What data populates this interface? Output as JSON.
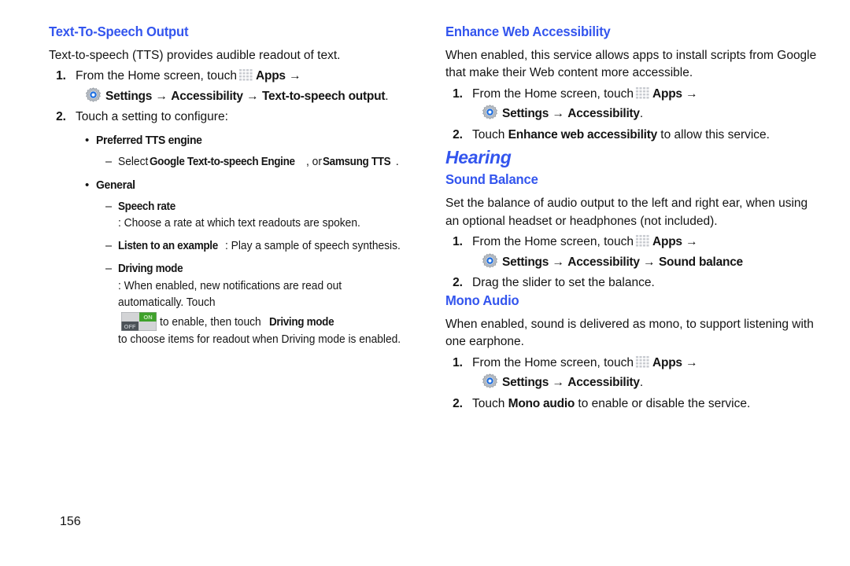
{
  "page": {
    "number": "156",
    "heading_color": "#3355ee",
    "text_color": "#141414"
  },
  "icons": {
    "apps": "apps-grid-icon",
    "settings": "settings-gear-icon",
    "toggle": "on-off-toggle-icon",
    "toggle_on_label": "ON",
    "toggle_off_label": "OFF"
  },
  "arrow": "→",
  "bullet_mark": "•",
  "dash_mark": "–",
  "left_column": {
    "tts": {
      "title": "Text-To-Speech Output",
      "intro": "Text-to-speech (TTS) provides audible readout of text.",
      "step1_num": "1.",
      "step1_text": "From the Home screen, touch",
      "step1_apps": "Apps",
      "step1_settings": "Settings",
      "step1_accessibility": "Accessibility",
      "step1_target": "Text-to-speech output",
      "step1_period": ".",
      "step2_num": "2.",
      "step2_text": "Touch a setting to configure:",
      "bullet1": "Preferred TTS engine",
      "bullet1_dash_pre": "Select ",
      "bullet1_dash_b1": "Google Text-to-speech Engine",
      "bullet1_dash_mid": ", or ",
      "bullet1_dash_b2": "Samsung TTS",
      "bullet1_dash_end": ".",
      "bullet2": "General",
      "dash_speech_rate_label": "Speech rate",
      "dash_speech_rate_text": ": Choose a rate at which text readouts are spoken.",
      "dash_listen_label": "Listen to an example",
      "dash_listen_text": ": Play a sample of speech synthesis.",
      "dash_driving_label": "Driving mode",
      "dash_driving_text1": ": When enabled, new notifications are read out automatically. Touch",
      "dash_driving_text2": "to enable, then touch",
      "dash_driving_b2": "Driving mode",
      "dash_driving_text3": "to choose items for readout when Driving mode is enabled."
    }
  },
  "right_column": {
    "enhance_web": {
      "title": "Enhance Web Accessibility",
      "intro": "When enabled, this service allows apps to install scripts from Google that make their Web content more accessible.",
      "step1_num": "1.",
      "step1_text": "From the Home screen, touch",
      "step1_apps": "Apps",
      "step1_settings": "Settings",
      "step1_accessibility": "Accessibility",
      "step1_period": ".",
      "step2_num": "2.",
      "step2_pre": "Touch ",
      "step2_bold": "Enhance web accessibility",
      "step2_post": " to allow this service."
    },
    "hearing_group": "Hearing",
    "sound_balance": {
      "title": "Sound Balance",
      "intro": "Set the balance of audio output to the left and right ear, when using an optional headset or headphones (not included).",
      "step1_num": "1.",
      "step1_text": "From the Home screen, touch",
      "step1_apps": "Apps",
      "step1_settings": "Settings",
      "step1_accessibility": "Accessibility",
      "step1_target": "Sound balance",
      "step2_num": "2.",
      "step2_text": "Drag the slider to set the balance."
    },
    "mono_audio": {
      "title": "Mono Audio",
      "intro": "When enabled, sound is delivered as mono, to support listening with one earphone.",
      "step1_num": "1.",
      "step1_text": "From the Home screen, touch",
      "step1_apps": "Apps",
      "step1_settings": "Settings",
      "step1_accessibility": "Accessibility",
      "step1_period": ".",
      "step2_num": "2.",
      "step2_pre": "Touch ",
      "step2_bold": "Mono audio",
      "step2_post": " to enable or disable the service."
    }
  }
}
